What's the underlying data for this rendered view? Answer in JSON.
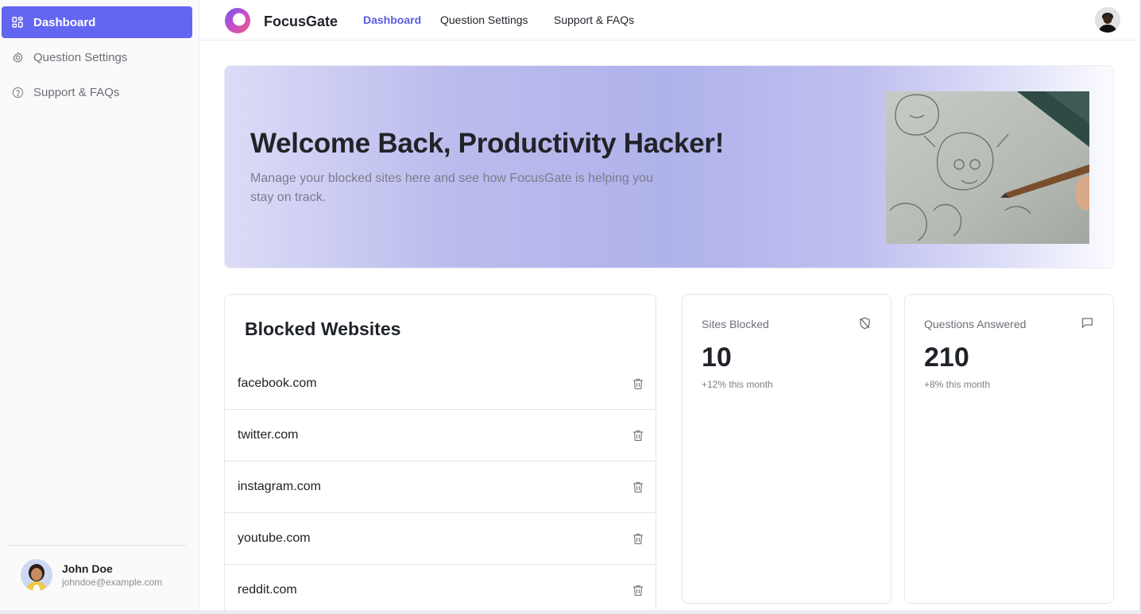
{
  "app": {
    "name": "FocusGate"
  },
  "sidebar": {
    "items": [
      {
        "label": "Dashboard",
        "icon": "dashboard-grid-icon",
        "active": true
      },
      {
        "label": "Question Settings",
        "icon": "gear-icon",
        "active": false
      },
      {
        "label": "Support & FAQs",
        "icon": "help-circle-icon",
        "active": false
      }
    ],
    "user": {
      "name": "John Doe",
      "email": "johndoe@example.com"
    }
  },
  "topnav": {
    "links": [
      {
        "label": "Dashboard",
        "active": true
      },
      {
        "label": "Question Settings",
        "active": false
      },
      {
        "label": "Support & FAQs",
        "active": false
      }
    ]
  },
  "hero": {
    "title": "Welcome Back, Productivity Hacker!",
    "subtitle": "Manage your blocked sites here and see how FocusGate is helping you stay on track."
  },
  "blocked": {
    "title": "Blocked Websites",
    "sites": [
      "facebook.com",
      "twitter.com",
      "instagram.com",
      "youtube.com",
      "reddit.com"
    ]
  },
  "stats": {
    "sites_blocked": {
      "label": "Sites Blocked",
      "value": "10",
      "change": "+12% this month",
      "icon": "shield-off-icon"
    },
    "questions_answered": {
      "label": "Questions Answered",
      "value": "210",
      "change": "+8% this month",
      "icon": "message-square-icon"
    }
  },
  "colors": {
    "accent": "#6366f1",
    "accent_text": "#5b5fe0"
  }
}
